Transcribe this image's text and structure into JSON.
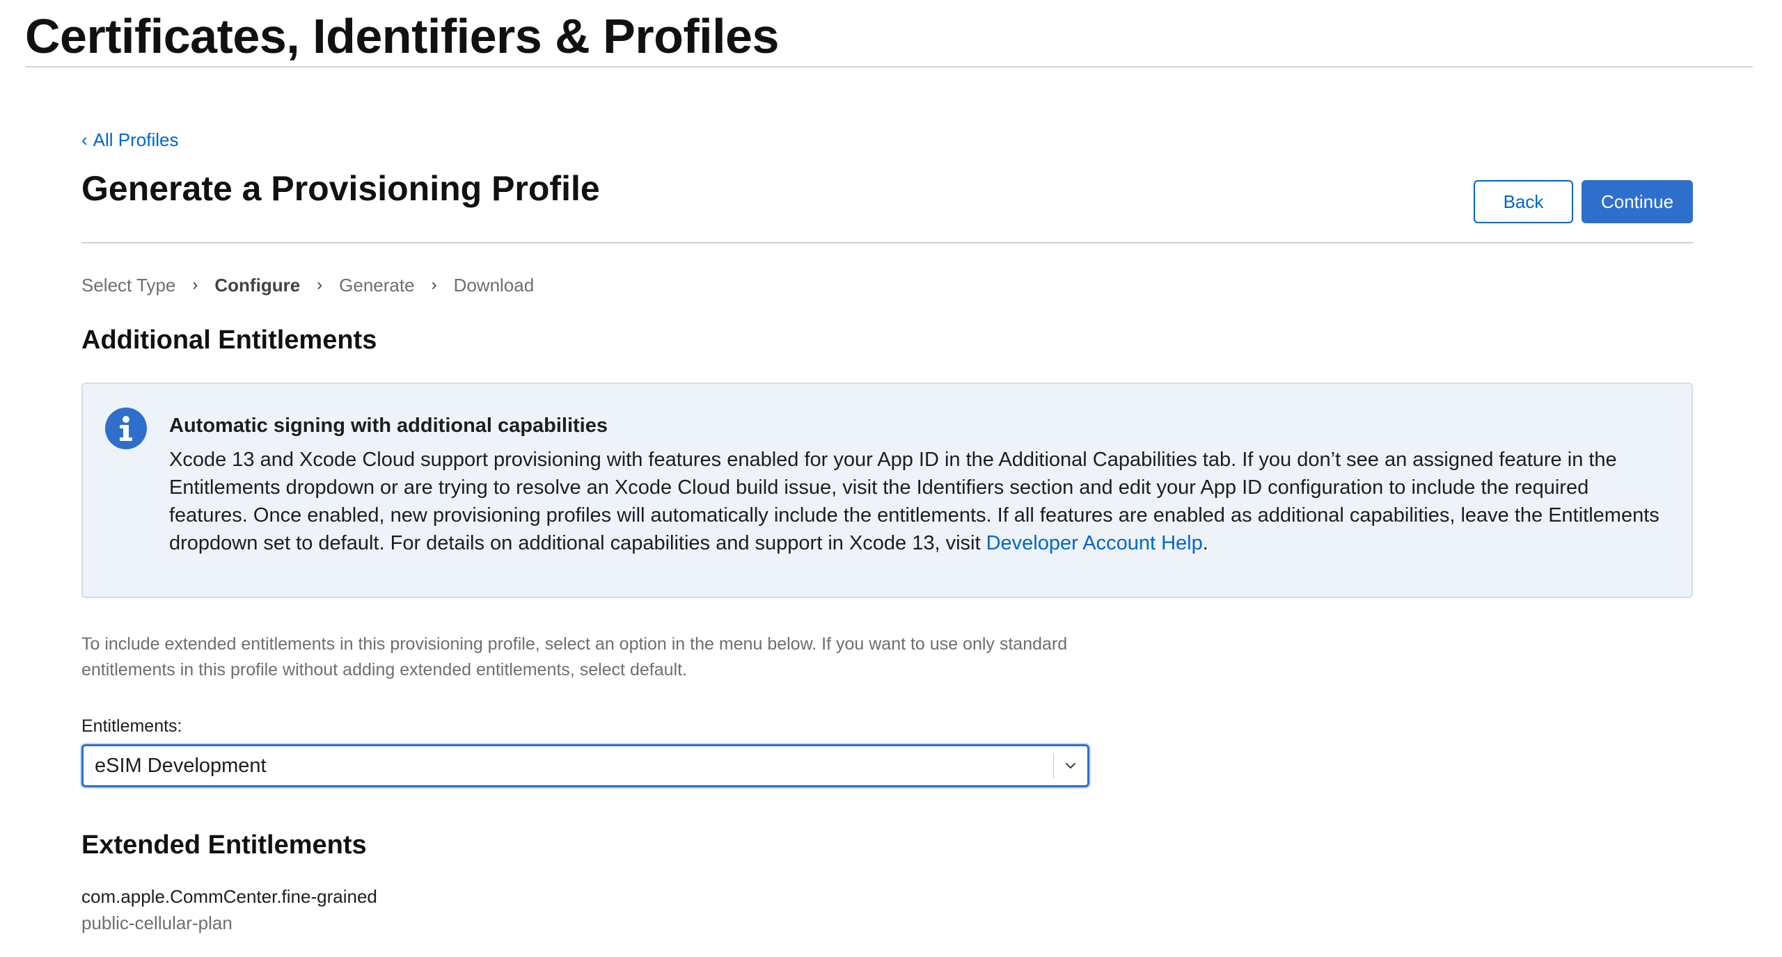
{
  "page": {
    "header_title": "Certificates, Identifiers & Profiles"
  },
  "nav": {
    "back_link": "All Profiles"
  },
  "main": {
    "title": "Generate a Provisioning Profile",
    "back_button": "Back",
    "continue_button": "Continue",
    "steps": [
      {
        "label": "Select Type",
        "active": false
      },
      {
        "label": "Configure",
        "active": true
      },
      {
        "label": "Generate",
        "active": false
      },
      {
        "label": "Download",
        "active": false
      }
    ],
    "additional_heading": "Additional Entitlements",
    "info": {
      "icon": "info-icon",
      "title": "Automatic signing with additional capabilities",
      "body": "Xcode 13 and Xcode Cloud support provisioning with features enabled for your App ID in the Additional Capabilities tab. If you don’t see an assigned feature in the Entitlements dropdown or are trying to resolve an Xcode Cloud build issue, visit the Identifiers section and edit your App ID configuration to include the required features. Once enabled, new provisioning profiles will automatically include the entitlements. If all features are enabled as additional capabilities, leave the Entitlements dropdown set to default. For details on additional capabilities and support in Xcode 13, visit ",
      "link": "Developer Account Help",
      "suffix": "."
    },
    "description": "To include extended entitlements in this provisioning profile, select an option in the menu below. If you want to use only standard entitlements in this profile without adding extended entitlements, select default.",
    "entitlements_label": "Entitlements:",
    "entitlements_value": "eSIM Development",
    "extended_heading": "Extended Entitlements",
    "extended": {
      "name": "com.apple.CommCenter.fine-grained",
      "value": "public-cellular-plan"
    }
  },
  "colors": {
    "accent": "#2e6fcb",
    "link": "#0066cc",
    "info_bg": "#eef3f9"
  }
}
